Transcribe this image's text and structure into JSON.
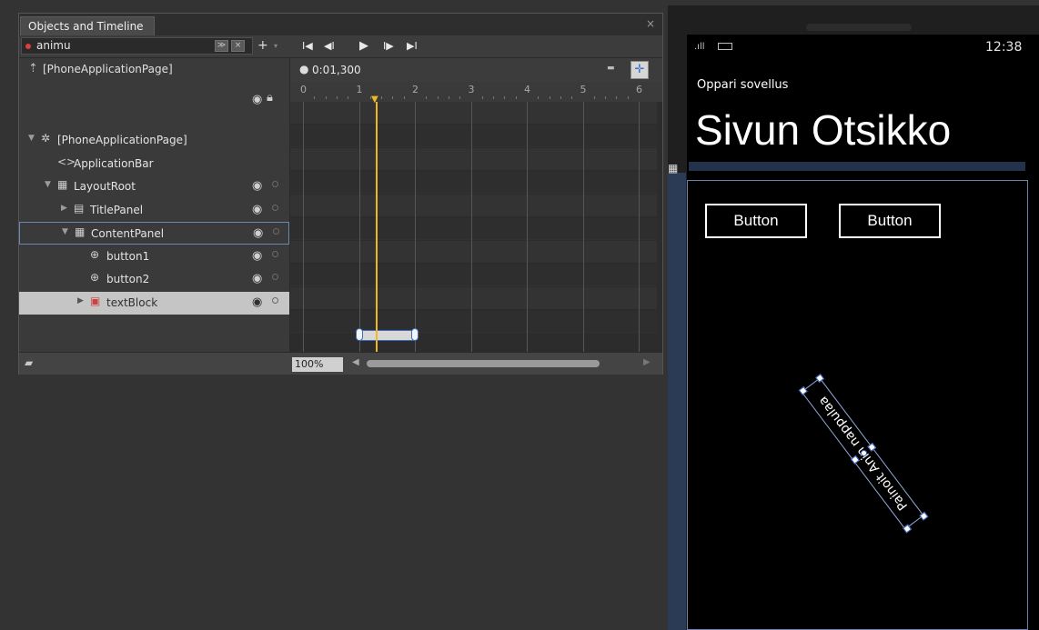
{
  "panel": {
    "tab_title": "Objects and Timeline",
    "close_glyph": "×",
    "storyboard": {
      "name": "animu"
    },
    "toolbar_glyphs": {
      "storyboard_menu": "≫",
      "close_storyboard": "×",
      "add": "+",
      "add_dropdown": "▾"
    },
    "playback": {
      "first": "I◀",
      "prev": "◀I",
      "play": "▶",
      "next": "I▶",
      "last": "▶I"
    },
    "scope_label": "[PhoneApplicationPage]",
    "time": "0:01,300",
    "zoom": "100%",
    "ruler_ticks": [
      "0",
      "1",
      "2",
      "3",
      "4",
      "5",
      "6"
    ],
    "header_icons": {
      "eye": "visibility-icon",
      "lock": "lock-icon"
    },
    "tree": [
      {
        "label": "[PhoneApplicationPage]",
        "icon": "page-icon",
        "glyph": "✲",
        "twisty": "▼",
        "indent": 0,
        "has_eye": false
      },
      {
        "label": "ApplicationBar",
        "icon": "code-brackets-icon",
        "glyph": "<>",
        "twisty": "",
        "indent": 1,
        "has_eye": false
      },
      {
        "label": "LayoutRoot",
        "icon": "grid-icon",
        "glyph": "▦",
        "twisty": "▼",
        "indent": 1,
        "has_eye": true
      },
      {
        "label": "TitlePanel",
        "icon": "stackpanel-icon",
        "glyph": "▤",
        "twisty": "▶",
        "indent": 2,
        "has_eye": true
      },
      {
        "label": "ContentPanel",
        "icon": "grid-icon",
        "glyph": "▦",
        "twisty": "▼",
        "indent": 2,
        "has_eye": true
      },
      {
        "label": "button1",
        "icon": "button-icon",
        "glyph": "⊕",
        "twisty": "",
        "indent": 3,
        "has_eye": true
      },
      {
        "label": "button2",
        "icon": "button-icon",
        "glyph": "⊕",
        "twisty": "",
        "indent": 3,
        "has_eye": true
      },
      {
        "label": "textBlock",
        "icon": "textblock-icon",
        "glyph": "▣",
        "twisty": "▶",
        "indent": 3,
        "has_eye": true
      }
    ],
    "keyframes_seconds": [
      1,
      2
    ],
    "playhead_seconds": 1.3
  },
  "phone": {
    "clock": "12:38",
    "app_title": "Oppari sovellus",
    "page_title": "Sivun Otsikko",
    "button1_label": "Button",
    "button2_label": "Button",
    "rotated_text": "Painoit Anin nappulaa"
  },
  "colors": {
    "accent": "#3a6fbf",
    "playhead": "#f0b820",
    "record": "#d94040"
  }
}
